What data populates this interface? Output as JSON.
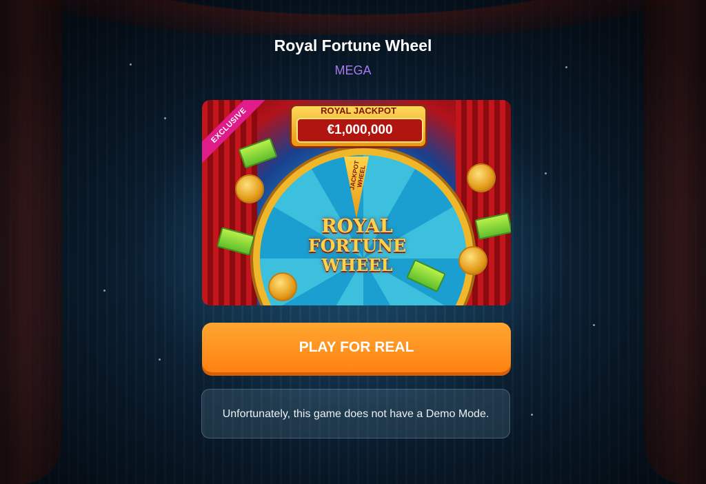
{
  "game": {
    "title": "Royal Fortune Wheel",
    "provider": "MEGA"
  },
  "thumbnail": {
    "ribbon": "EXCLUSIVE",
    "jackpot_label": "ROYAL JACKPOT",
    "jackpot_amount": "€1,000,000",
    "pointer_text": "JACKPOT WHEEL",
    "logo_line1": "ROYAL",
    "logo_line2": "FORTUNE",
    "logo_line3": "WHEEL"
  },
  "actions": {
    "play_label": "PLAY FOR REAL"
  },
  "notice": {
    "text": "Unfortunately, this game does not have a Demo Mode."
  },
  "colors": {
    "provider": "#a77bf0",
    "play_button": "#ff8c1a",
    "background": "#0b2034"
  }
}
